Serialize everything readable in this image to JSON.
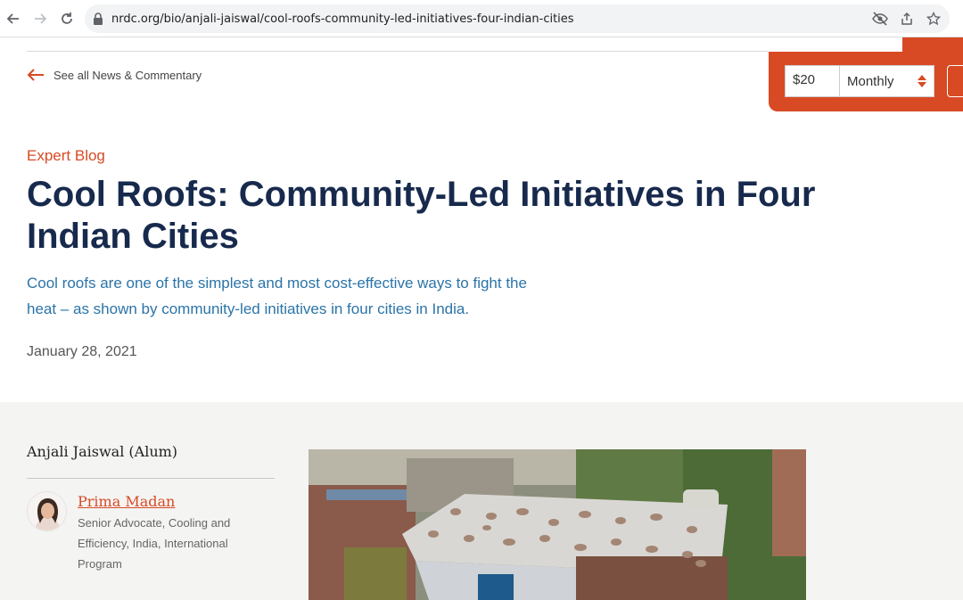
{
  "browser": {
    "url": "nrdc.org/bio/anjali-jaiswal/cool-roofs-community-led-initiatives-four-indian-cities"
  },
  "header": {
    "back_link": "See all News & Commentary"
  },
  "donate": {
    "amount": "$20",
    "frequency": "Monthly"
  },
  "article": {
    "eyebrow": "Expert Blog",
    "title": "Cool Roofs: Community-Led Initiatives in Four Indian Cities",
    "dek": "Cool roofs are one of the simplest and most cost-effective ways to fight the heat – as shown by community-led initiatives in four cities in India.",
    "date": "January 28, 2021"
  },
  "byline": {
    "heading": "Anjali Jaiswal (Alum)",
    "author_name": "Prima Madan",
    "author_role": "Senior Advocate, Cooling and Efficiency, India, International Program"
  },
  "colors": {
    "accent": "#d84a24",
    "title": "#172a4d",
    "dek": "#2b74a8"
  }
}
